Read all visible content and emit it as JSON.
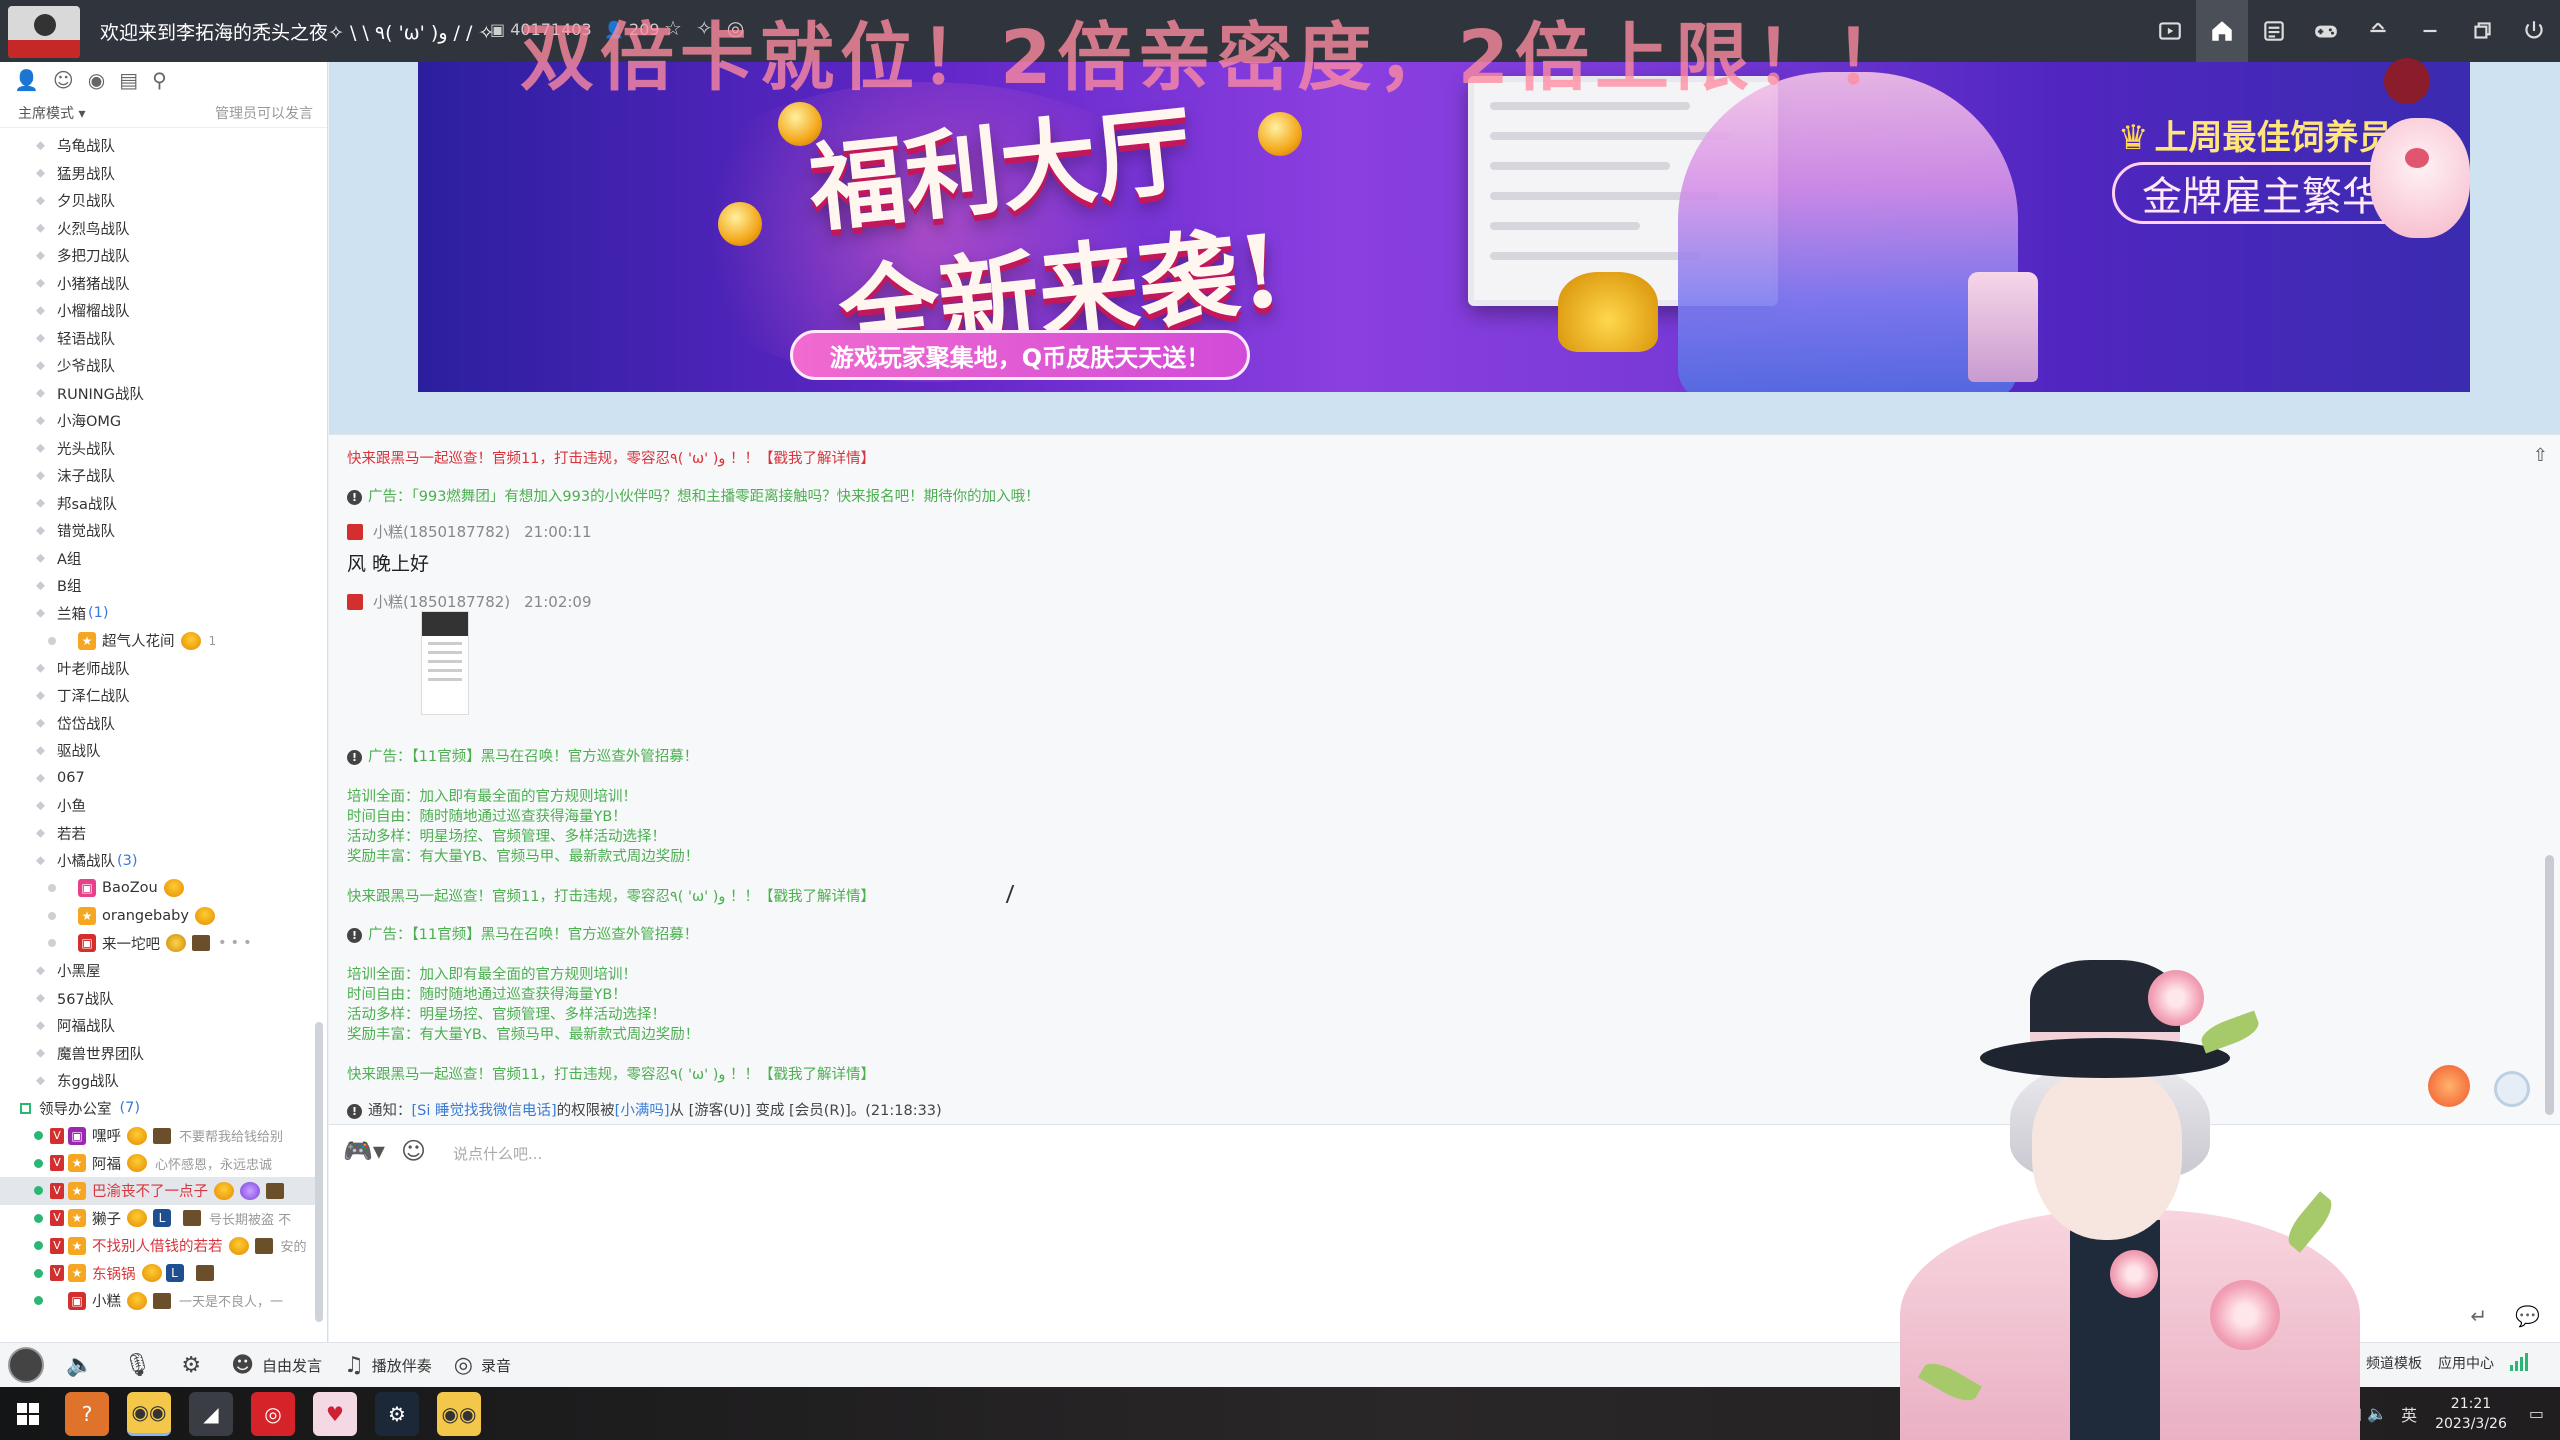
{
  "window": {
    "title": "欢迎来到李拓海的秃头之夜✧ \\ \\ ٩( 'ω' )و / / ✧",
    "channel_id": "40171403",
    "online_count": "209",
    "overlay_text": "双倍卡就位！2倍亲密度，2倍上限！！"
  },
  "sidebar": {
    "mode_label": "主席模式",
    "mode_hint": "管理员可以发言",
    "groups": [
      {
        "label": "乌龟战队"
      },
      {
        "label": "猛男战队"
      },
      {
        "label": "夕贝战队"
      },
      {
        "label": "火烈鸟战队"
      },
      {
        "label": "多把刀战队"
      },
      {
        "label": "小猪猪战队"
      },
      {
        "label": "小榴榴战队"
      },
      {
        "label": "轻语战队"
      },
      {
        "label": "少爷战队"
      },
      {
        "label": "RUNING战队"
      },
      {
        "label": "小海OMG"
      },
      {
        "label": "光头战队"
      },
      {
        "label": "沫子战队"
      },
      {
        "label": "邦sa战队"
      },
      {
        "label": "错觉战队"
      },
      {
        "label": "A组"
      },
      {
        "label": "B组"
      }
    ],
    "lanyin": {
      "label": "兰箱",
      "count": "(1)",
      "member": "超气人花间",
      "member_extra": "1"
    },
    "groups2": [
      {
        "label": "叶老师战队"
      },
      {
        "label": "丁泽仁战队"
      },
      {
        "label": "岱岱战队"
      },
      {
        "label": "驱战队"
      },
      {
        "label": "067"
      },
      {
        "label": "小鱼"
      },
      {
        "label": "若若"
      }
    ],
    "orange": {
      "label": "小橘战队",
      "count": "(3)",
      "members": [
        "BaoZou",
        "orangebaby",
        "来一坨吧"
      ]
    },
    "groups3": [
      {
        "label": "小黑屋"
      },
      {
        "label": "567战队"
      },
      {
        "label": "阿福战队"
      },
      {
        "label": "魔兽世界团队"
      },
      {
        "label": "东gg战队"
      }
    ],
    "office": {
      "label": "领导办公室",
      "count": "(7)"
    },
    "office_members": [
      {
        "name": "嘿呼",
        "sig": "不要帮我给钱给别"
      },
      {
        "name": "阿福",
        "sig": "心怀感恩，永远忠诚"
      },
      {
        "name": "巴渝丧不了一点子",
        "sig": ""
      },
      {
        "name": "獭子",
        "sig": "号长期被盗 不"
      },
      {
        "name": "不找别人借钱的若若",
        "sig": "安的"
      },
      {
        "name": "东锅锅",
        "sig": ""
      },
      {
        "name": "小糕",
        "sig": "一天是不良人，一"
      }
    ]
  },
  "banner": {
    "title_line1": "福利大厅",
    "title_line2": "全新来袭!",
    "pill": "游戏玩家聚集地，Q币皮肤天天送！",
    "best_label": "上周最佳饲养员",
    "best_name": "金牌雇主繁华哥"
  },
  "chat": {
    "promo1": "快来跟黑马一起巡查！官频11，打击违规，零容忍٩( 'ω' )و ！！【戳我了解详情】",
    "ad1": "广告：「993燃舞团」有想加入993的小伙伴吗？想和主播零距离接触吗？快来报名吧！期待你的加入哦！",
    "msg1_sender": "小糕(1850187782)",
    "msg1_time": "21:00:11",
    "msg1_text": "风 晚上好",
    "msg2_sender": "小糕(1850187782)",
    "msg2_time": "21:02:09",
    "ad2": "广告：【11官频】黑马在召唤！官方巡查外管招募！",
    "ad2_lines": [
      "培训全面：加入即有最全面的官方规则培训！",
      "时间自由：随时随地通过巡查获得海量YB！",
      "活动多样：明星场控、官频管理、多样活动选择！",
      "奖励丰富：有大量YB、官频马甲、最新款式周边奖励！"
    ],
    "promo2": "快来跟黑马一起巡查！官频11，打击违规，零容忍٩( 'ω' )و ！！【戳我了解详情】",
    "ad3": "广告：【11官频】黑马在召唤！官方巡查外管招募！",
    "ad3_lines": [
      "培训全面：加入即有最全面的官方规则培训！",
      "时间自由：随时随地通过巡查获得海量YB！",
      "活动多样：明星场控、官频管理、多样活动选择！",
      "奖励丰富：有大量YB、官频马甲、最新款式周边奖励！"
    ],
    "promo3": "快来跟黑马一起巡查！官频11，打击违规，零容忍٩( 'ω' )و ！！【戳我了解详情】",
    "notice_prefix": "通知：",
    "notice_user": "[Si 睡觉找我微信电话]",
    "notice_mid": "的权限被",
    "notice_op": "[小满吗]",
    "notice_from": "从 [游客(U)] 变成 [会员(R)]。(21:18:33)"
  },
  "input": {
    "placeholder": "说点什么吧..."
  },
  "bottombar": {
    "free_talk": "自由发言",
    "play_music": "播放伴奏",
    "record": "录音",
    "channel_template": "频道模板",
    "app_center": "应用中心"
  },
  "taskbar": {
    "time": "21:21",
    "date": "2023/3/26",
    "ime": "英"
  },
  "colors": {
    "titlebar": "#30343c",
    "red_msg": "#d8343b",
    "green_msg": "#4caf50",
    "link_blue": "#3a7bd5"
  }
}
